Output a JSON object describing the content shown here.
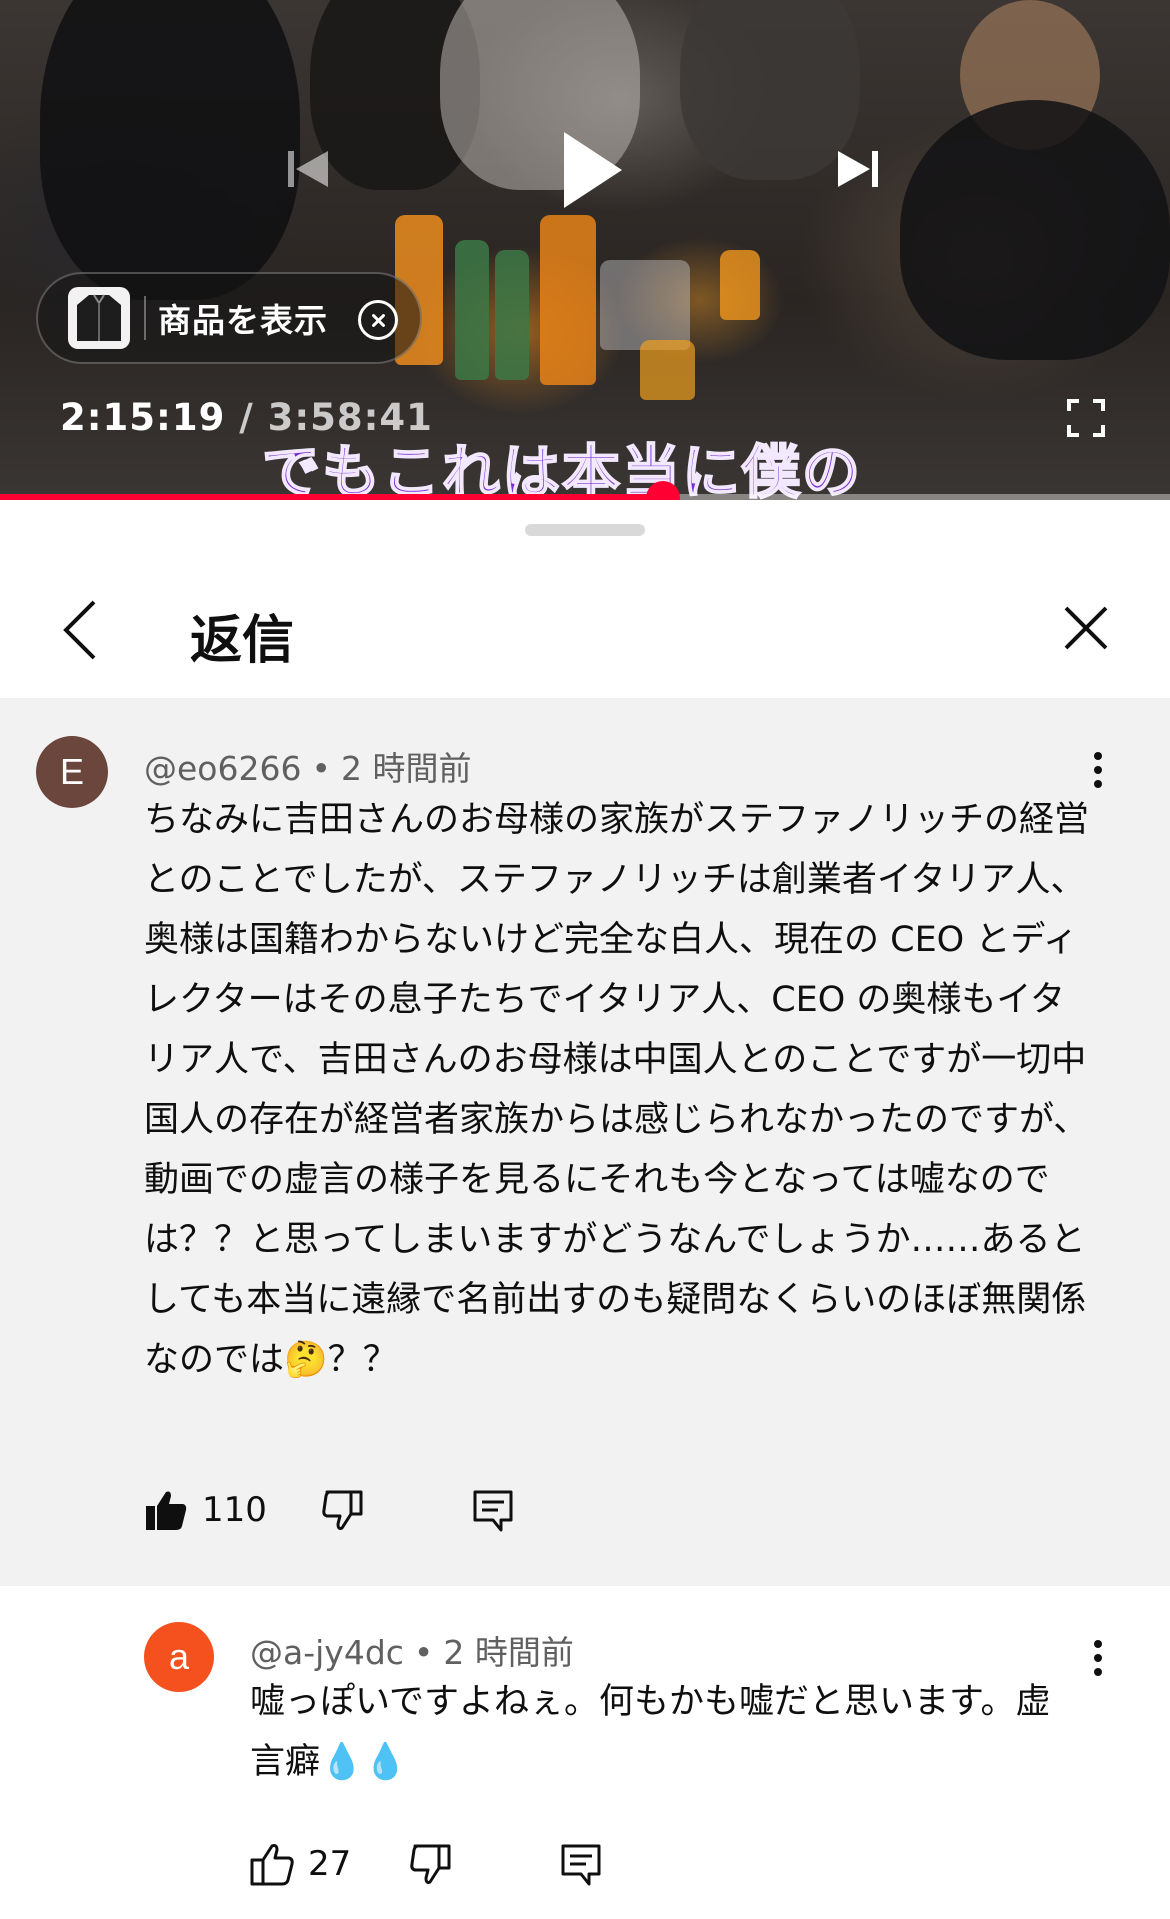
{
  "player": {
    "product_chip_label": "商品を表示",
    "current_time": "2:15:19",
    "separator": " / ",
    "total_time": "3:58:41",
    "subtitle": "でもこれは本当に僕の",
    "progress_fraction": 0.567
  },
  "sheet": {
    "title": "返信"
  },
  "parent_comment": {
    "avatar_letter": "E",
    "avatar_color": "#6a463c",
    "author": "@eo6266",
    "time": "2 時間前",
    "text": "ちなみに吉田さんのお母様の家族がステファノリッチの経営とのことでしたが、ステファノリッチは創業者イタリア人、奥様は国籍わからないけど完全な白人、現在の CEO とディレクターはその息子たちでイタリア人、CEO の奥様もイタリア人で、吉田さんのお母様は中国人とのことですが一切中国人の存在が経営者家族からは感じられなかったのですが、動画での虚言の様子を見るにそれも今となっては嘘なのでは？？と思ってしまいますがどうなんでしょうか……あるとしても本当に遠縁で名前出すのも疑問なくらいのほぼ無関係なのでは🤔？？",
    "likes": "110"
  },
  "reply_comment": {
    "avatar_letter": "a",
    "avatar_color": "#f4511e",
    "author": "@a-jy4dc",
    "time": "2 時間前",
    "text": "嘘っぽいですよねぇ。何もかも嘘だと思います。虚言癖💧💧",
    "likes": "27"
  },
  "colors": {
    "accent_red": "#ff0033",
    "subtitle_purple": "#7a2fd0",
    "parent_bg": "#f2f2f2"
  },
  "icons": [
    "previous-icon",
    "play-icon",
    "next-icon",
    "jacket-thumbnail",
    "close-chip-icon",
    "fullscreen-icon",
    "back-arrow-icon",
    "close-icon",
    "more-vert-icon",
    "like-icon",
    "dislike-icon",
    "reply-icon"
  ]
}
